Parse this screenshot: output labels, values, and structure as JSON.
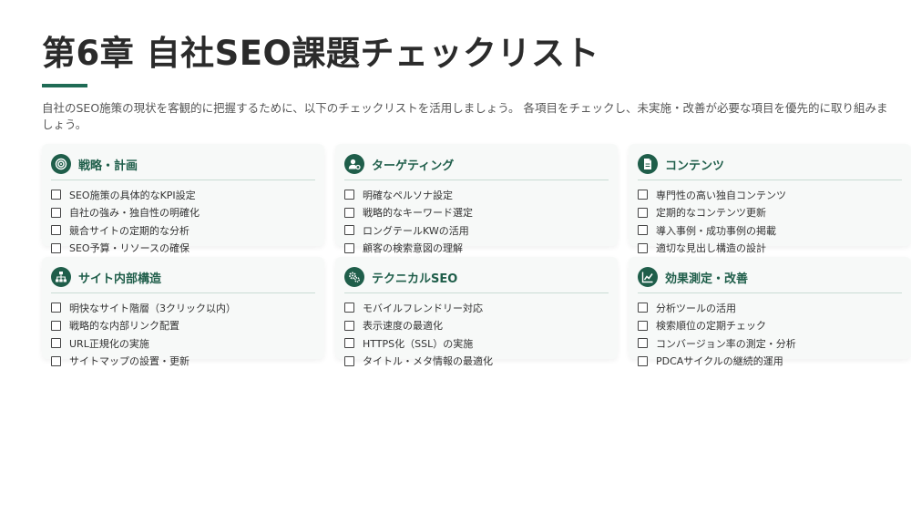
{
  "header": {
    "title": "第6章 自社SEO課題チェックリスト",
    "intro": "自社のSEO施策の現状を客観的に把握するために、以下のチェックリストを活用しましょう。 各項目をチェックし、未実施・改善が必要な項目を優先的に取り組みましょう。"
  },
  "accent_color": "#1f5e4a",
  "cards": [
    {
      "icon": "target-icon",
      "title": "戦略・計画",
      "items": [
        "SEO施策の具体的なKPI設定",
        "自社の強み・独自性の明確化",
        "競合サイトの定期的な分析",
        "SEO予算・リソースの確保"
      ]
    },
    {
      "icon": "user-gear-icon",
      "title": "ターゲティング",
      "items": [
        "明確なペルソナ設定",
        "戦略的なキーワード選定",
        "ロングテールKWの活用",
        "顧客の検索意図の理解"
      ]
    },
    {
      "icon": "document-icon",
      "title": "コンテンツ",
      "items": [
        "専門性の高い独自コンテンツ",
        "定期的なコンテンツ更新",
        "導入事例・成功事例の掲載",
        "適切な見出し構造の設計"
      ]
    },
    {
      "icon": "sitemap-icon",
      "title": "サイト内部構造",
      "items": [
        "明快なサイト階層（3クリック以内）",
        "戦略的な内部リンク配置",
        "URL正規化の実施",
        "サイトマップの設置・更新"
      ]
    },
    {
      "icon": "gears-icon",
      "title": "テクニカルSEO",
      "items": [
        "モバイルフレンドリー対応",
        "表示速度の最適化",
        "HTTPS化（SSL）の実施",
        "タイトル・メタ情報の最適化"
      ]
    },
    {
      "icon": "chart-line-icon",
      "title": "効果測定・改善",
      "items": [
        "分析ツールの活用",
        "検索順位の定期チェック",
        "コンバージョン率の測定・分析",
        "PDCAサイクルの継続的運用"
      ]
    }
  ]
}
